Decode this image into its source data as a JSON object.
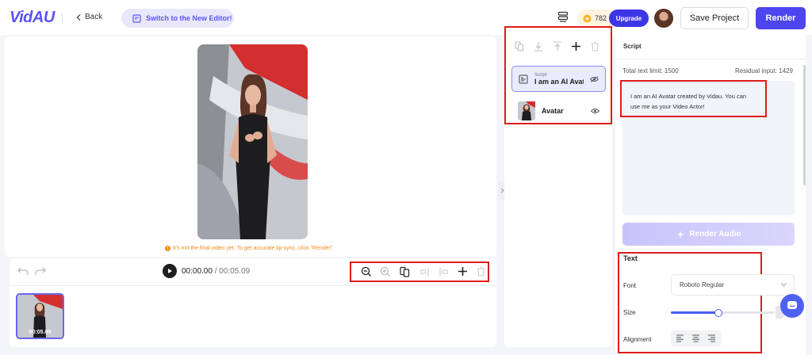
{
  "header": {
    "logo": "VidAU",
    "back_label": "Back",
    "switch_label": "Switch to the New Editor!",
    "credits": "782",
    "upgrade_label": "Upgrade",
    "save_label": "Save Project",
    "render_label": "Render"
  },
  "preview": {
    "notice": "It's not the final video yet. To get accurate lip-sync, click \"Render\"."
  },
  "timeline": {
    "current_time": "00:00.00",
    "separator": " / ",
    "total_time": "00:05.09",
    "clip_duration": "00:05.09",
    "tools": [
      "zoom-out-icon",
      "zoom-in-icon",
      "split-icon",
      "align-left-icon",
      "align-center-icon",
      "add-icon",
      "delete-icon"
    ]
  },
  "layers": {
    "items": [
      {
        "type": "Script",
        "label": "I am an AI Avat..."
      },
      {
        "type": "",
        "label": "Avatar"
      }
    ]
  },
  "script_panel": {
    "title": "Script",
    "total_limit": "Total text limit: 1500",
    "residual": "Residual input: 1429",
    "text": "I am an AI Avatar created by Vidau. You can use me as your Video Actor!",
    "render_audio_label": "Render Audio"
  },
  "text_settings": {
    "section_title": "Text",
    "font_label": "Font",
    "font_value": "Roboto Regular",
    "size_label": "Size",
    "size_level": 0.46,
    "alignment_label": "Alignment"
  },
  "colors": {
    "accent": "#4c45f0",
    "highlight_box": "#e01b1b",
    "notice": "#f08c1a"
  }
}
